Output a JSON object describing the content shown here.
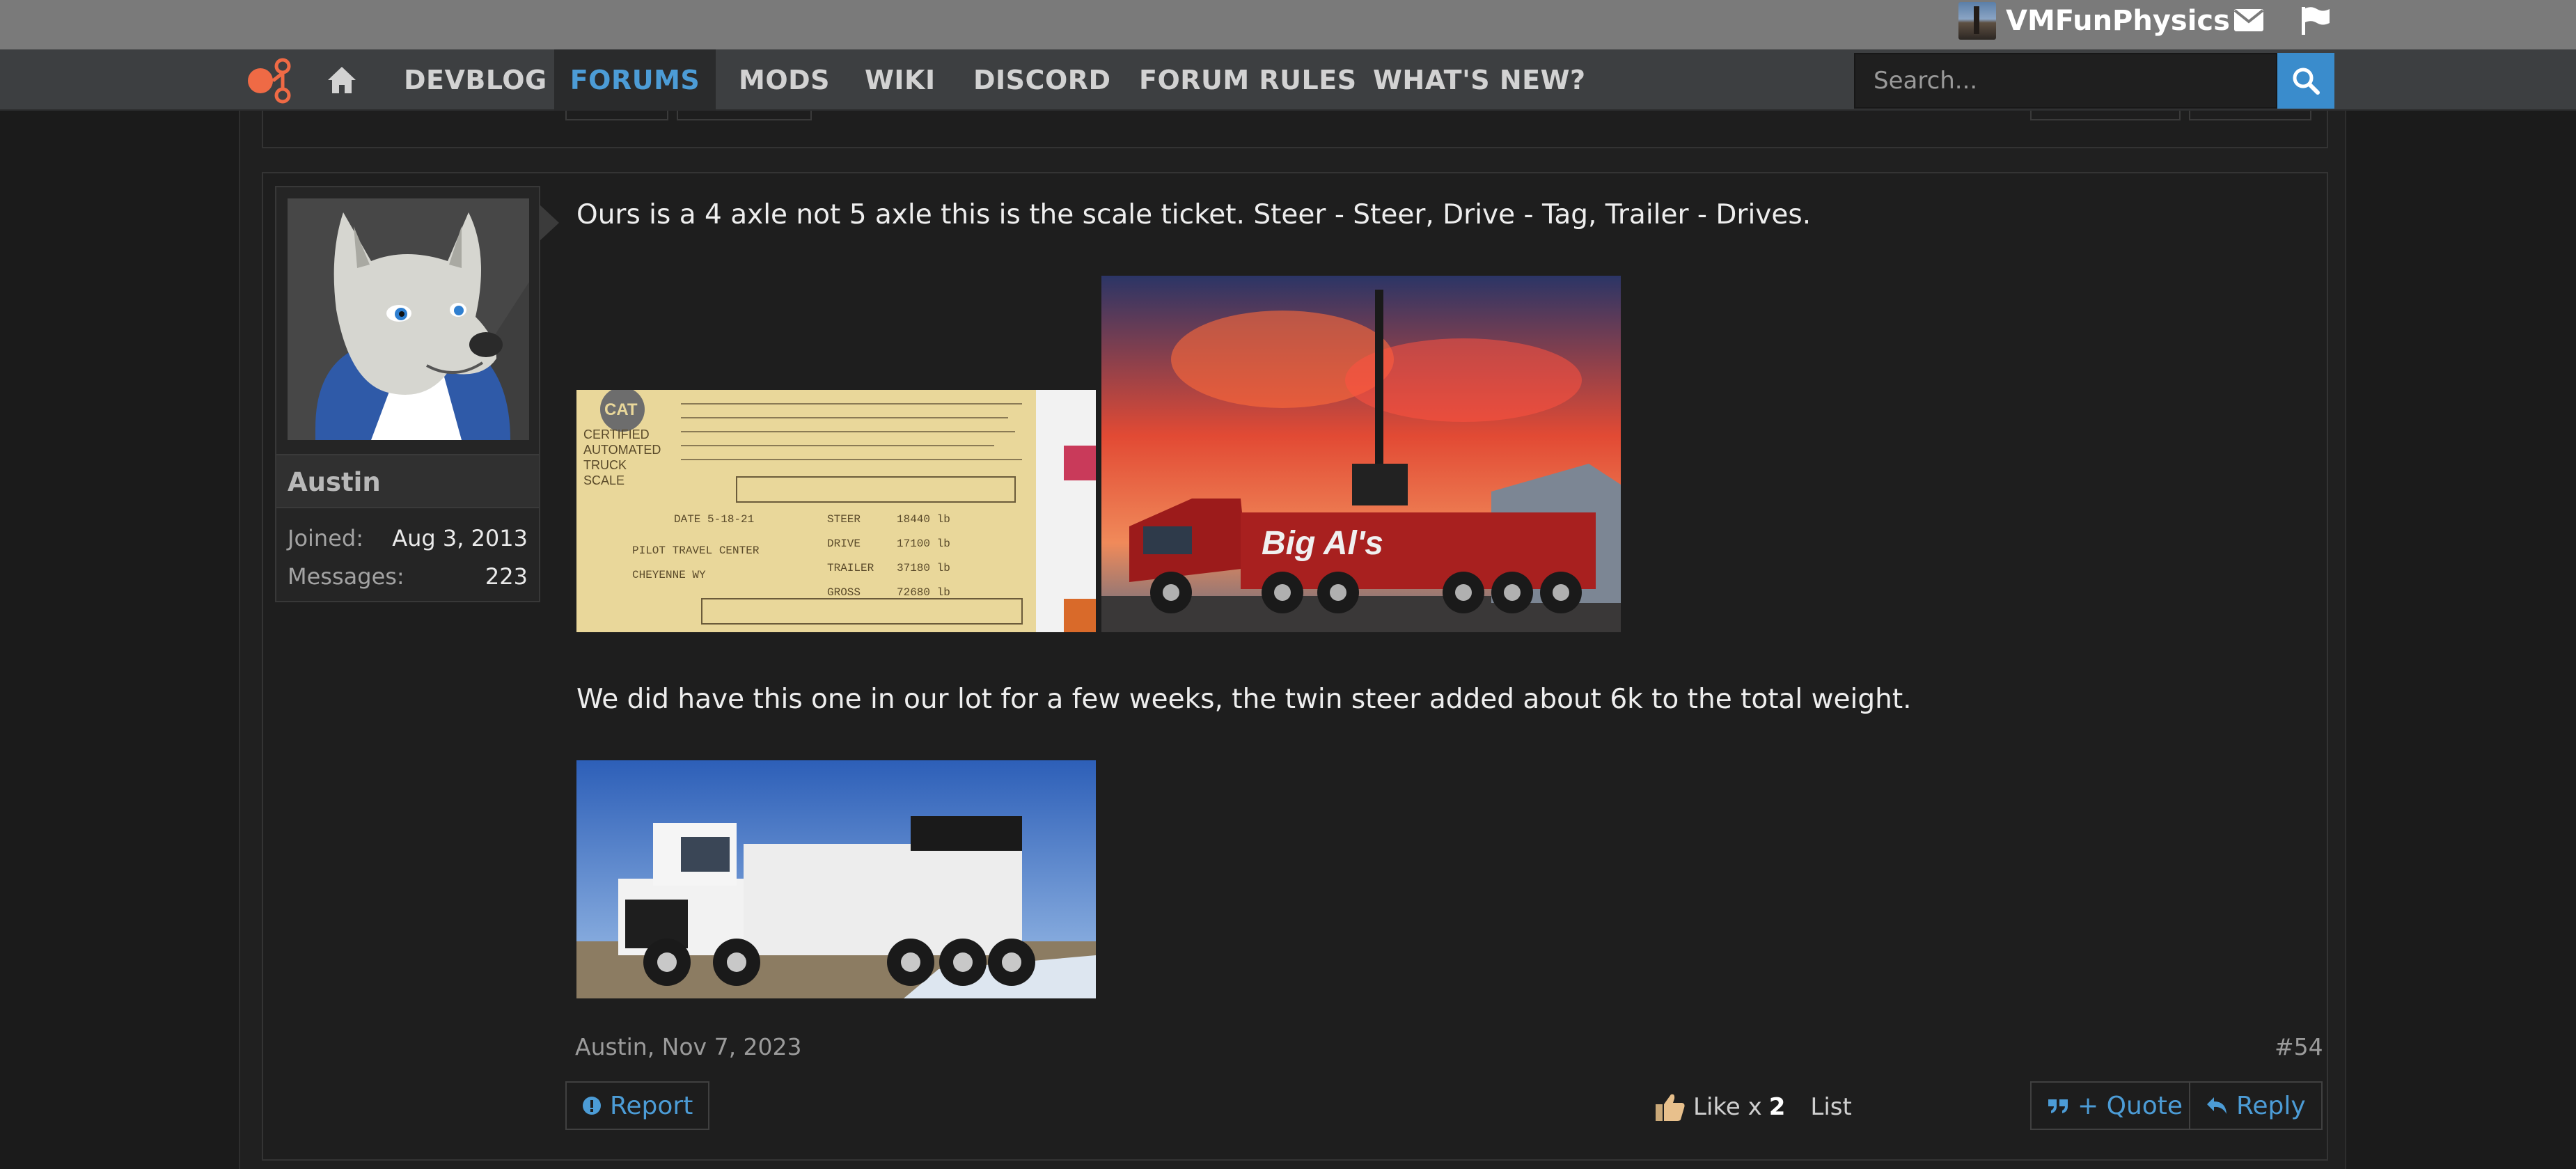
{
  "user_bar": {
    "username": "VMFunPhysics",
    "icons": [
      "envelope-icon",
      "flag-icon"
    ]
  },
  "nav": {
    "items": [
      {
        "label": "DEVBLOG"
      },
      {
        "label": "FORUMS"
      },
      {
        "label": "MODS"
      },
      {
        "label": "WIKI"
      },
      {
        "label": "DISCORD"
      },
      {
        "label": "FORUM RULES"
      },
      {
        "label": "WHAT'S NEW?"
      }
    ],
    "active": "FORUMS",
    "search_placeholder": "Search..."
  },
  "post": {
    "author": {
      "name": "Austin",
      "joined_label": "Joined:",
      "joined_value": "Aug 3, 2013",
      "messages_label": "Messages:",
      "messages_value": "223"
    },
    "paragraphs": [
      "Ours is a 4 axle not 5 axle this is the scale ticket. Steer - Steer, Drive - Tag, Trailer - Drives.",
      "We did have this one in our lot for a few weeks, the twin steer added about 6k to the total weight."
    ],
    "images": [
      {
        "name": "scale-ticket-image",
        "alt": "CAT scale ticket"
      },
      {
        "name": "red-tow-truck-image",
        "alt": "Big Al's red tow truck at sunset"
      },
      {
        "name": "white-tow-truck-image",
        "alt": "White twin steer tow truck"
      }
    ],
    "meta": {
      "author_date": "Austin, Nov 7, 2023",
      "post_number": "#54"
    },
    "actions": {
      "report": "Report",
      "like_prefix": "Like x",
      "like_count": "2",
      "list": "List",
      "quote": "+ Quote",
      "reply": "Reply"
    }
  },
  "colors": {
    "accent": "#4c9cd6",
    "background": "#1b1b1b",
    "nav_bg": "#3d3f41",
    "user_bar_bg": "#7a7a7a"
  }
}
